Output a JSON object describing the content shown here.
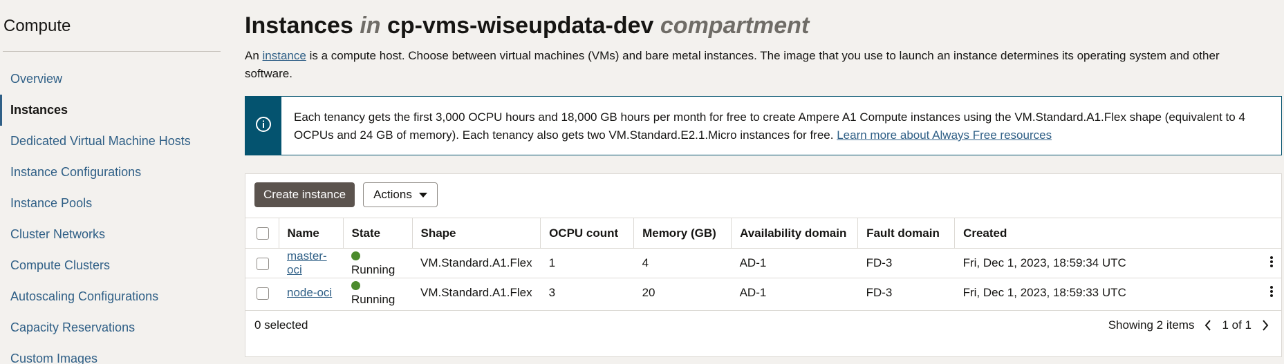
{
  "sidebar": {
    "title": "Compute",
    "items": [
      {
        "label": "Overview"
      },
      {
        "label": "Instances"
      },
      {
        "label": "Dedicated Virtual Machine Hosts"
      },
      {
        "label": "Instance Configurations"
      },
      {
        "label": "Instance Pools"
      },
      {
        "label": "Cluster Networks"
      },
      {
        "label": "Compute Clusters"
      },
      {
        "label": "Autoscaling Configurations"
      },
      {
        "label": "Capacity Reservations"
      },
      {
        "label": "Custom Images"
      }
    ]
  },
  "header": {
    "title_main": "Instances",
    "title_in": "in",
    "compartment": "cp-vms-wiseupdata-dev",
    "title_suffix": "compartment"
  },
  "intro": {
    "prefix": "An",
    "link": "instance",
    "rest": "is a compute host. Choose between virtual machines (VMs) and bare metal instances. The image that you use to launch an instance determines its operating system and other software."
  },
  "banner": {
    "text": "Each tenancy gets the first 3,000 OCPU hours and 18,000 GB hours per month for free to create Ampere A1 Compute instances using the VM.Standard.A1.Flex shape (equivalent to 4 OCPUs and 24 GB of memory). Each tenancy also gets two VM.Standard.E2.1.Micro instances for free.",
    "link": "Learn more about Always Free resources"
  },
  "toolbar": {
    "create_label": "Create instance",
    "actions_label": "Actions"
  },
  "table": {
    "headers": [
      "Name",
      "State",
      "Shape",
      "OCPU count",
      "Memory (GB)",
      "Availability domain",
      "Fault domain",
      "Created"
    ],
    "rows": [
      {
        "name": "master-oci",
        "state": "Running",
        "shape": "VM.Standard.A1.Flex",
        "ocpu": "1",
        "memory": "4",
        "ad": "AD-1",
        "fd": "FD-3",
        "created": "Fri, Dec 1, 2023, 18:59:34 UTC"
      },
      {
        "name": "node-oci",
        "state": "Running",
        "shape": "VM.Standard.A1.Flex",
        "ocpu": "3",
        "memory": "20",
        "ad": "AD-1",
        "fd": "FD-3",
        "created": "Fri, Dec 1, 2023, 18:59:33 UTC"
      }
    ]
  },
  "footer": {
    "selected": "0 selected",
    "showing": "Showing 2 items",
    "page": "1 of 1"
  },
  "colors": {
    "accent": "#04536f",
    "link": "#2f5f86",
    "running": "#4b8b2c",
    "primary_button": "#5b534e"
  },
  "icons": {
    "banner": "info-icon",
    "actions": "caret-down-icon",
    "row_menu": "kebab-icon",
    "prev": "chevron-left-icon",
    "next": "chevron-right-icon"
  }
}
